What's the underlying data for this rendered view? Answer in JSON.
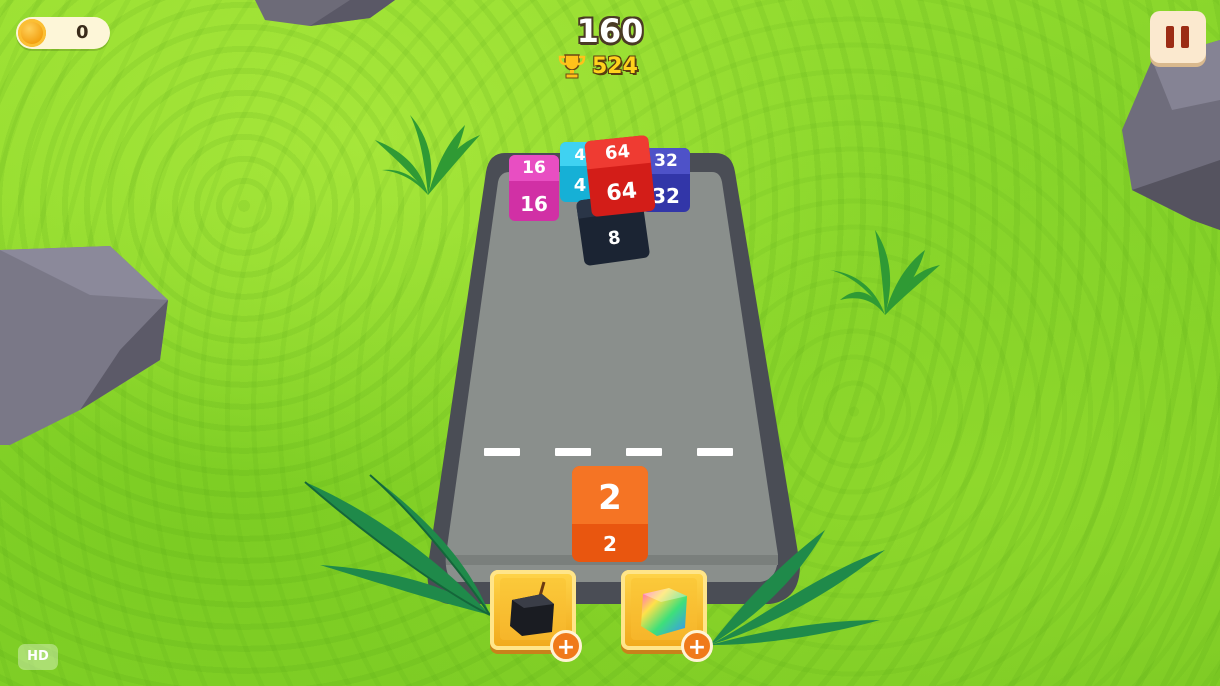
{
  "hud": {
    "coins": "0",
    "score": "160",
    "best_score": "524",
    "quality_badge": "HD"
  },
  "board_cubes": [
    {
      "value": "16",
      "color": "#e23bb4"
    },
    {
      "value": "4",
      "color": "#1fc4e8"
    },
    {
      "value": "64",
      "color": "#e2231e"
    },
    {
      "value": "32",
      "color": "#3c3fb8"
    },
    {
      "value": "8",
      "color": "#1f2a3a"
    }
  ],
  "shooter_cube": {
    "value": "2",
    "color": "#f36c1c"
  },
  "powerups": [
    {
      "name": "bomb",
      "icon": "bomb-icon"
    },
    {
      "name": "rainbow-cube",
      "icon": "rainbow-cube-icon"
    }
  ],
  "colors": {
    "grass": "#8fd82c",
    "board": "#8a8f8c",
    "board_rim": "#4a4d55",
    "accent_orange": "#f07a1a"
  }
}
